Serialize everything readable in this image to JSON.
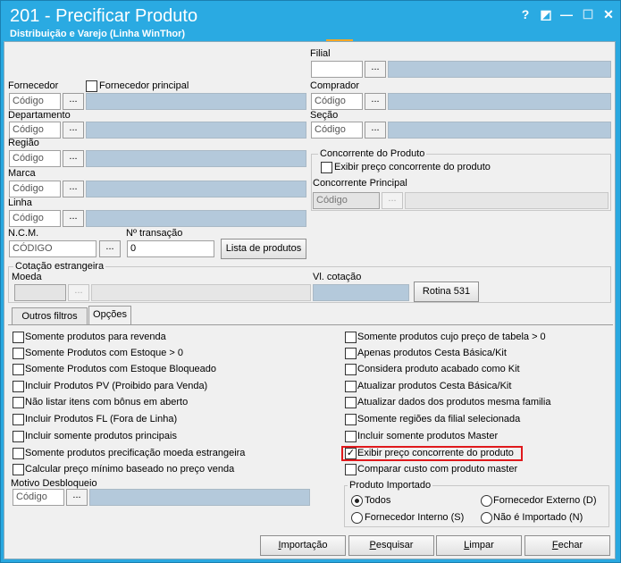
{
  "window": {
    "title": "201 - Precificar Produto",
    "subtitle": "Distribuição e Varejo (Linha WinThor)",
    "buttons": {
      "help": "?",
      "restore": "◩",
      "minimize": "—",
      "maximize": "☐",
      "close": "✕"
    }
  },
  "form": {
    "filial_label": "Filial",
    "fornecedor_label": "Fornecedor",
    "fornecedor_principal_label": "Fornecedor principal",
    "comprador_label": "Comprador",
    "departamento_label": "Departamento",
    "secao_label": "Seção",
    "regiao_label": "Região",
    "marca_label": "Marca",
    "linha_label": "Linha",
    "ncm_label": "N.C.M.",
    "transacao_label": "Nº transação",
    "codigo_placeholder": "Código",
    "ncm_placeholder": "CÓDIGO",
    "transacao_value": "0",
    "dots": "...",
    "lista_produtos": "Lista de produtos"
  },
  "concorrente": {
    "group_label": "Concorrente do Produto",
    "exibir_label": "Exibir preço concorrente do produto",
    "principal_label": "Concorrente Principal",
    "codigo": "Código"
  },
  "cotacao": {
    "group_label": "Cotação estrangeira",
    "moeda_label": "Moeda",
    "vl_label": "Vl. cotação",
    "rotina_button": "Rotina 531"
  },
  "tabs": [
    "Outros filtros",
    "Opções"
  ],
  "options_left": [
    "Somente produtos para revenda",
    "Somente Produtos com Estoque > 0",
    "Somente Produtos com Estoque Bloqueado",
    "Incluir Produtos PV (Proibido para Venda)",
    "Não listar itens com bônus em aberto",
    "Incluir Produtos FL (Fora de Linha)",
    "Incluir somente produtos principais",
    "Somente produtos precificação moeda estrangeira",
    "Calcular preço mínimo baseado no preço venda"
  ],
  "options_right": [
    "Somente produtos cujo preço de tabela > 0",
    "Apenas produtos Cesta Básica/Kit",
    "Considera produto acabado como Kit",
    "Atualizar produtos Cesta Básica/Kit",
    "Atualizar dados dos produtos mesma familia",
    "Somente regiões da filial selecionada",
    "Incluir somente produtos Master",
    "Exibir preço concorrente do produto",
    "Comparar custo com produto master"
  ],
  "motivo": {
    "label": "Motivo Desbloqueio",
    "codigo": "Código"
  },
  "produto_importado": {
    "label": "Produto Importado",
    "todos": "Todos",
    "fornecedor_externo": "Fornecedor Externo (D)",
    "fornecedor_interno": "Fornecedor Interno (S)",
    "nao_importado": "Não é Importado (N)"
  },
  "footer": {
    "importacao_pre": "",
    "importacao_u": "I",
    "importacao_post": "mportação",
    "pesquisar_pre": "",
    "pesquisar_u": "P",
    "pesquisar_post": "esquisar",
    "limpar_pre": "",
    "limpar_u": "L",
    "limpar_post": "impar",
    "fechar_pre": "",
    "fechar_u": "F",
    "fechar_post": "echar"
  },
  "colors": {
    "titlebar": "#2aaae2",
    "highlight": "#e0191c",
    "accent": "#f5a623"
  }
}
